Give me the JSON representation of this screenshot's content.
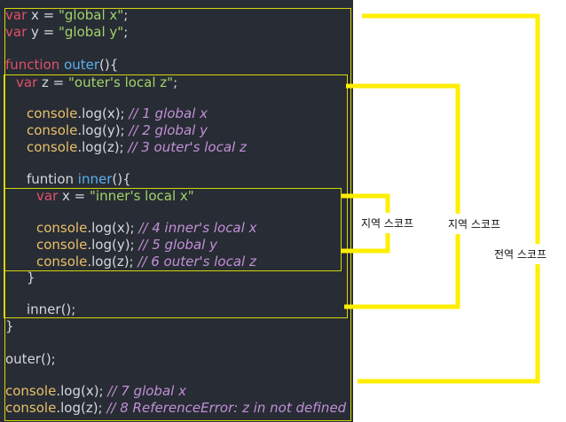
{
  "code": {
    "l1": {
      "kw": "var",
      "rest": " x = ",
      "str": "\"global x\"",
      "end": ";"
    },
    "l2": {
      "kw": "var",
      "rest": " y = ",
      "str": "\"global y\"",
      "end": ";"
    },
    "l4": {
      "kw": "function",
      "fn": "outer",
      "end": "(){"
    },
    "l5": {
      "kw": "var",
      "rest": " z = ",
      "str": "\"outer's local z\"",
      "end": ";"
    },
    "l7": {
      "obj": "console",
      "call": ".log(x); ",
      "cm": "// 1 global x"
    },
    "l8": {
      "obj": "console",
      "call": ".log(y); ",
      "cm": "// 2 global y"
    },
    "l9": {
      "obj": "console",
      "call": ".log(z); ",
      "cm": "// 3 outer's local z"
    },
    "l11": {
      "kw": "funtion ",
      "fn": "inner",
      "end": "(){"
    },
    "l12": {
      "kw": "var",
      "rest": " x = ",
      "str": "\"inner's local x\""
    },
    "l14": {
      "obj": "console",
      "call": ".log(x); ",
      "cm": "// 4 inner's local x"
    },
    "l15": {
      "obj": "console",
      "call": ".log(y); ",
      "cm": "// 5 global y"
    },
    "l16": {
      "obj": "console",
      "call": ".log(z); ",
      "cm": "// 6 outer's local z"
    },
    "l17": "}",
    "l19": "inner();",
    "l20": "}",
    "l22": "outer();",
    "l24": {
      "obj": "console",
      "call": ".log(x); ",
      "cm": "// 7 global x"
    },
    "l25": {
      "obj": "console",
      "call": ".log(z); ",
      "cm": "// 8 ReferenceError: z in not defined"
    }
  },
  "labels": {
    "inner_scope": "지역 스코프",
    "outer_scope": "지역 스코프",
    "global_scope": "전역 스코프"
  },
  "colors": {
    "editor_bg": "#282c34",
    "bracket": "#ffee00",
    "scope_border": "#d6d60a"
  }
}
